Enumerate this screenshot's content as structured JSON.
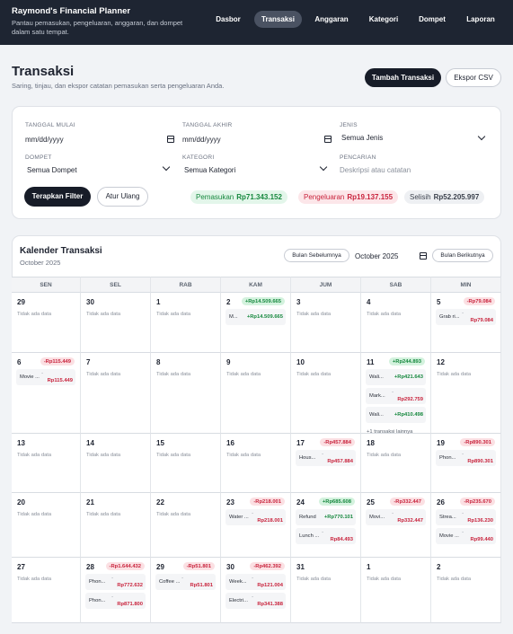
{
  "app": {
    "title": "Raymond's Financial Planner",
    "subtitle_line1": "Pantau pemasukan, pengeluaran, anggaran, dan dompet",
    "subtitle_line2": "dalam satu tempat."
  },
  "nav": [
    "Dasbor",
    "Transaksi",
    "Anggaran",
    "Kategori",
    "Dompet",
    "Laporan"
  ],
  "nav_active": "Transaksi",
  "page": {
    "title": "Transaksi",
    "subtitle": "Saring, tinjau, dan ekspor catatan pemasukan serta pengeluaran Anda.",
    "add_button": "Tambah Transaksi",
    "export_button": "Ekspor CSV"
  },
  "filters": {
    "start_label": "TANGGAL MULAI",
    "start_value": "mm/dd/yyyy",
    "end_label": "TANGGAL AKHIR",
    "end_value": "mm/dd/yyyy",
    "type_label": "JENIS",
    "type_value": "Semua Jenis",
    "wallet_label": "DOMPET",
    "wallet_value": "Semua Dompet",
    "category_label": "KATEGORI",
    "category_value": "Semua Kategori",
    "search_label": "PENCARIAN",
    "search_placeholder": "Deskripsi atau catatan",
    "apply_button": "Terapkan Filter",
    "reset_button": "Atur Ulang",
    "summary": {
      "income_label": "Pemasukan",
      "income_value": "Rp71.343.152",
      "expense_label": "Pengeluaran",
      "expense_value": "Rp19.137.155",
      "diff_label": "Selisih",
      "diff_value": "Rp52.205.997"
    },
    "colors": {
      "income": "#16883e",
      "expense": "#c9243d"
    }
  },
  "calendar": {
    "title": "Kalender Transaksi",
    "month_label": "October 2025",
    "prev_button": "Bulan Sebelumnya",
    "next_button": "Bulan Berikutnya",
    "month_input": "October 2025",
    "weekdays": [
      "SEN",
      "SEL",
      "RAB",
      "KAM",
      "JUM",
      "SAB",
      "MIN"
    ],
    "no_data": "Tidak ada data",
    "weeks": [
      [
        {
          "day": "29"
        },
        {
          "day": "30"
        },
        {
          "day": "1"
        },
        {
          "day": "2",
          "total": "+Rp14.509.665",
          "sign": "pos",
          "entries": [
            {
              "name": "M...",
              "amount": "+Rp14.509.665",
              "sign": "pos"
            }
          ]
        },
        {
          "day": "3"
        },
        {
          "day": "4"
        },
        {
          "day": "5",
          "total": "-Rp79.084",
          "sign": "neg",
          "entries": [
            {
              "name": "Grab ri...",
              "amount": "Rp79.084",
              "sign": "neg"
            }
          ]
        }
      ],
      [
        {
          "day": "6",
          "total": "-Rp115.449",
          "sign": "neg",
          "entries": [
            {
              "name": "Movie ...",
              "amount": "Rp115.449",
              "sign": "neg"
            }
          ]
        },
        {
          "day": "7"
        },
        {
          "day": "8"
        },
        {
          "day": "9"
        },
        {
          "day": "10"
        },
        {
          "day": "11",
          "total": "+Rp244.893",
          "sign": "pos",
          "entries": [
            {
              "name": "Wali...",
              "amount": "+Rp421.643",
              "sign": "pos"
            },
            {
              "name": "Mark...",
              "amount": "Rp292.759",
              "sign": "neg"
            },
            {
              "name": "Wali...",
              "amount": "+Rp410.498",
              "sign": "pos"
            }
          ],
          "more": "+1 transaksi lainnya"
        },
        {
          "day": "12"
        }
      ],
      [
        {
          "day": "13"
        },
        {
          "day": "14"
        },
        {
          "day": "15"
        },
        {
          "day": "16"
        },
        {
          "day": "17",
          "total": "-Rp457.884",
          "sign": "neg",
          "entries": [
            {
              "name": "Hous...",
              "amount": "Rp457.884",
              "sign": "neg"
            }
          ]
        },
        {
          "day": "18"
        },
        {
          "day": "19",
          "total": "-Rp890.301",
          "sign": "neg",
          "entries": [
            {
              "name": "Phon...",
              "amount": "Rp890.301",
              "sign": "neg"
            }
          ]
        }
      ],
      [
        {
          "day": "20"
        },
        {
          "day": "21"
        },
        {
          "day": "22"
        },
        {
          "day": "23",
          "total": "-Rp218.001",
          "sign": "neg",
          "entries": [
            {
              "name": "Water ...",
              "amount": "Rp218.001",
              "sign": "neg"
            }
          ]
        },
        {
          "day": "24",
          "total": "+Rp685.608",
          "sign": "pos",
          "entries": [
            {
              "name": "Refund",
              "amount": "+Rp770.101",
              "sign": "pos"
            },
            {
              "name": "Lunch ...",
              "amount": "Rp84.493",
              "sign": "neg"
            }
          ]
        },
        {
          "day": "25",
          "total": "-Rp332.447",
          "sign": "neg",
          "entries": [
            {
              "name": "Movi...",
              "amount": "Rp332.447",
              "sign": "neg"
            }
          ]
        },
        {
          "day": "26",
          "total": "-Rp235.670",
          "sign": "neg",
          "entries": [
            {
              "name": "Strea...",
              "amount": "Rp136.230",
              "sign": "neg"
            },
            {
              "name": "Movie ...",
              "amount": "Rp99.440",
              "sign": "neg"
            }
          ]
        }
      ],
      [
        {
          "day": "27"
        },
        {
          "day": "28",
          "total": "-Rp1.644.432",
          "sign": "neg",
          "entries": [
            {
              "name": "Phon...",
              "amount": "Rp772.632",
              "sign": "neg"
            },
            {
              "name": "Phon...",
              "amount": "Rp871.800",
              "sign": "neg"
            }
          ]
        },
        {
          "day": "29",
          "total": "-Rp51.801",
          "sign": "neg",
          "entries": [
            {
              "name": "Coffee ...",
              "amount": "Rp51.801",
              "sign": "neg"
            }
          ]
        },
        {
          "day": "30",
          "total": "-Rp462.392",
          "sign": "neg",
          "entries": [
            {
              "name": "Week...",
              "amount": "Rp121.004",
              "sign": "neg"
            },
            {
              "name": "Electri...",
              "amount": "Rp341.388",
              "sign": "neg"
            }
          ]
        },
        {
          "day": "31"
        },
        {
          "day": "1"
        },
        {
          "day": "2"
        }
      ]
    ]
  }
}
